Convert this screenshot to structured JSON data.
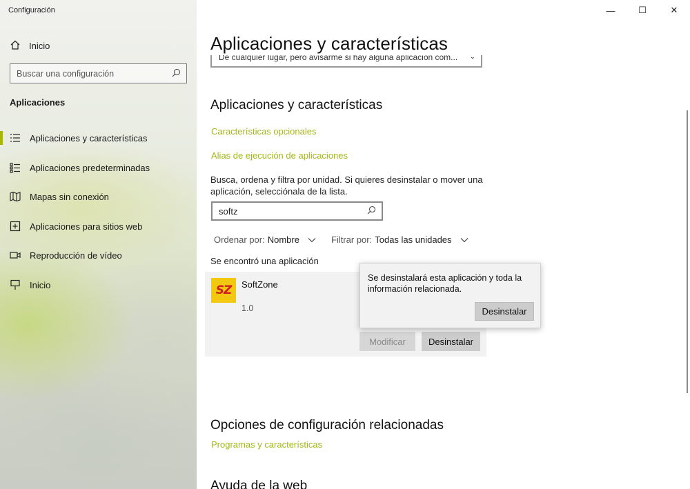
{
  "window": {
    "title": "Configuración",
    "controls": {
      "minimize": "—",
      "maximize": "☐",
      "close": "✕"
    }
  },
  "sidebar": {
    "home_label": "Inicio",
    "search_placeholder": "Buscar una configuración",
    "section_title": "Aplicaciones",
    "items": [
      {
        "label": "Aplicaciones y características",
        "icon": "list-icon",
        "active": true
      },
      {
        "label": "Aplicaciones predeterminadas",
        "icon": "default-apps-icon",
        "active": false
      },
      {
        "label": "Mapas sin conexión",
        "icon": "map-icon",
        "active": false
      },
      {
        "label": "Aplicaciones para sitios web",
        "icon": "web-apps-icon",
        "active": false
      },
      {
        "label": "Reproducción de vídeo",
        "icon": "video-icon",
        "active": false
      },
      {
        "label": "Inicio",
        "icon": "startup-icon",
        "active": false
      }
    ]
  },
  "main": {
    "page_title": "Aplicaciones y características",
    "install_source_dropdown_value": "De cualquier lugar, pero avisarme si hay alguna aplicación com...",
    "section_title": "Aplicaciones y características",
    "links": {
      "optional_features": "Características opcionales",
      "app_execution_aliases": "Alias de ejecución de aplicaciones"
    },
    "description": "Busca, ordena y filtra por unidad. Si quieres desinstalar o mover una aplicación, selecciónala de la lista.",
    "search_value": "softz",
    "sort": {
      "label": "Ordenar por:",
      "value": "Nombre"
    },
    "filter": {
      "label": "Filtrar por:",
      "value": "Todas las unidades"
    },
    "result_text": "Se encontró una aplicación",
    "app": {
      "name": "SoftZone",
      "version": "1.0",
      "logo_text": "SZ",
      "modify_label": "Modificar",
      "uninstall_label": "Desinstalar"
    },
    "popup": {
      "text": "Se desinstalará esta aplicación y toda la información relacionada.",
      "button_label": "Desinstalar"
    },
    "related_title": "Opciones de configuración relacionadas",
    "related_link": "Programas y características",
    "help_title": "Ayuda de la web"
  },
  "colors": {
    "accent_link": "#a4b814",
    "active_indicator": "#a8b800",
    "logo_bg": "#f2c811",
    "logo_text": "#d11f1f"
  }
}
